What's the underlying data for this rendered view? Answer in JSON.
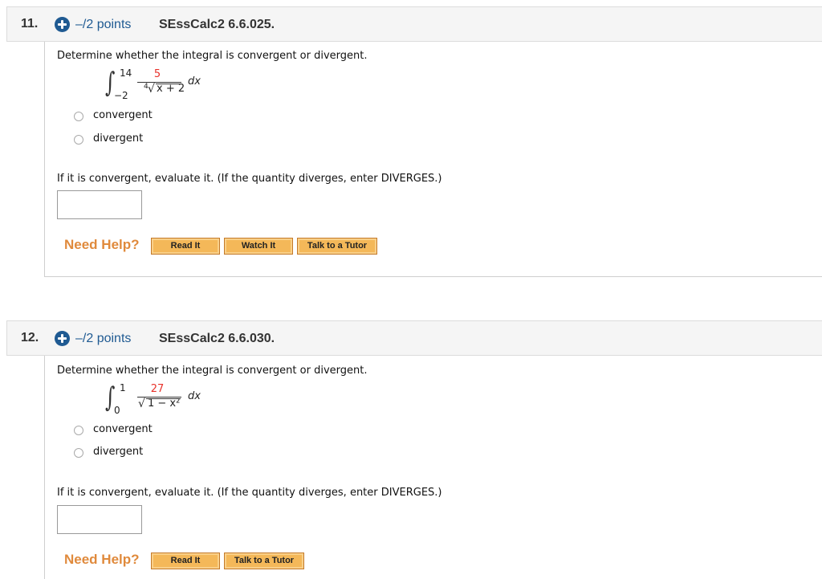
{
  "questions": [
    {
      "number": "11.",
      "points": "–/2 points",
      "reference": "SEssCalc2 6.6.025.",
      "prompt": "Determine whether the integral is convergent or divergent.",
      "integral": {
        "lower": "−2",
        "upper": "14",
        "numerator": "5",
        "root_index": "4",
        "radicand": "x + 2",
        "differential": "dx"
      },
      "options": [
        "convergent",
        "divergent"
      ],
      "evaluate_prompt": "If it is convergent, evaluate it. (If the quantity diverges, enter DIVERGES.)",
      "answer_value": "",
      "need_help_label": "Need Help?",
      "help_buttons": [
        "Read It",
        "Watch It",
        "Talk to a Tutor"
      ]
    },
    {
      "number": "12.",
      "points": "–/2 points",
      "reference": "SEssCalc2 6.6.030.",
      "prompt": "Determine whether the integral is convergent or divergent.",
      "integral": {
        "lower": "0",
        "upper": "1",
        "numerator": "27",
        "root_index": "",
        "radicand": "1 − x²",
        "differential": "dx"
      },
      "options": [
        "convergent",
        "divergent"
      ],
      "evaluate_prompt": "If it is convergent, evaluate it. (If the quantity diverges, enter DIVERGES.)",
      "answer_value": "",
      "need_help_label": "Need Help?",
      "help_buttons": [
        "Read It",
        "Talk to a Tutor"
      ]
    }
  ],
  "colors": {
    "points_blue": "#1f5a92",
    "need_help_orange": "#e08a3c",
    "button_fill": "#f4b859",
    "numerator_red": "#e8322b"
  }
}
